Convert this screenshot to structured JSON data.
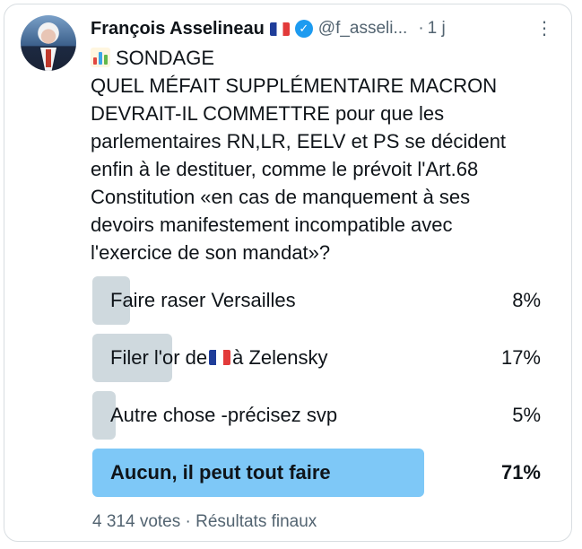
{
  "author": {
    "name": "François Asselineau",
    "handle": "@f_asseli...",
    "time": "1 j",
    "separator": "·"
  },
  "post": {
    "label": "SONDAGE",
    "text": "QUEL MÉFAIT SUPPLÉMENTAIRE MACRON\nDEVRAIT-IL COMMETTRE pour que les\nparlementaires RN,LR, EELV et PS se décident\nenfin à le destituer, comme le prévoit l'Art.68\nConstitution «en cas de manquement à ses\ndevoirs manifestement incompatible avec\nl'exercice de son mandat»?"
  },
  "poll": {
    "options": [
      {
        "label": "Faire raser Versailles",
        "percent_text": "8%",
        "percent": 8
      },
      {
        "label_before": "Filer l'or de",
        "label_after": "à Zelensky",
        "percent_text": "17%",
        "percent": 17
      },
      {
        "label": "Autre chose -précisez svp",
        "percent_text": "5%",
        "percent": 5
      },
      {
        "label": "Aucun, il peut tout faire",
        "percent_text": "71%",
        "percent": 71
      }
    ],
    "footer": "4 314 votes · Résultats finaux"
  },
  "icons": {
    "flag": "france-flag-icon",
    "verified": "verified-badge-icon",
    "more": "more-options-icon",
    "chart": "bar-chart-icon"
  },
  "colors": {
    "accent": "#1d9bf0",
    "winner_bar": "#7ec8f7",
    "bar": "#cfd9de",
    "muted": "#536471"
  }
}
